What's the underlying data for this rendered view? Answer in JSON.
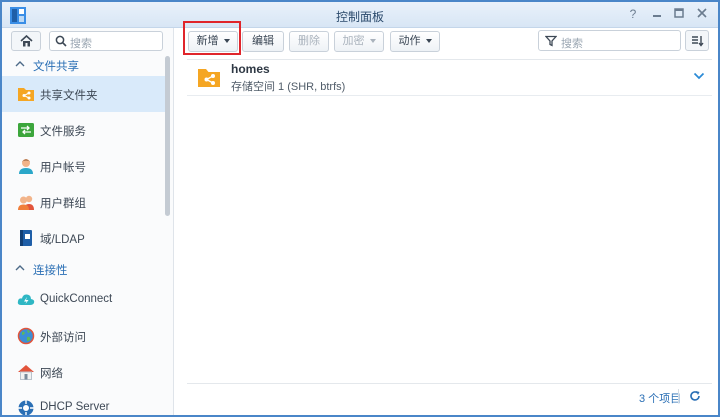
{
  "window": {
    "title": "控制面板"
  },
  "sidebar": {
    "search_placeholder": "搜索",
    "sections": [
      {
        "label": "文件共享"
      },
      {
        "label": "连接性"
      }
    ],
    "items": [
      {
        "label": "共享文件夹",
        "icon": "shared-folder-icon",
        "active": true
      },
      {
        "label": "文件服务",
        "icon": "file-services-icon"
      },
      {
        "label": "用户帐号",
        "icon": "user-icon"
      },
      {
        "label": "用户群组",
        "icon": "group-icon"
      },
      {
        "label": "域/LDAP",
        "icon": "domain-ldap-icon"
      },
      {
        "label": "QuickConnect",
        "icon": "quickconnect-icon"
      },
      {
        "label": "外部访问",
        "icon": "external-access-icon"
      },
      {
        "label": "网络",
        "icon": "network-icon"
      },
      {
        "label": "DHCP Server",
        "icon": "dhcp-icon"
      }
    ]
  },
  "toolbar": {
    "create_label": "新增",
    "edit_label": "编辑",
    "delete_label": "删除",
    "encrypt_label": "加密",
    "action_label": "动作",
    "filter_placeholder": "搜索"
  },
  "list": {
    "rows": [
      {
        "name": "homes",
        "location": "存储空间 1 (SHR, btrfs)"
      }
    ]
  },
  "footer": {
    "count": "3 个项目"
  },
  "colors": {
    "accent": "#2a6fb5",
    "folder": "#f5a623",
    "highlight": "#e0252b",
    "selected": "#d9eafa"
  }
}
